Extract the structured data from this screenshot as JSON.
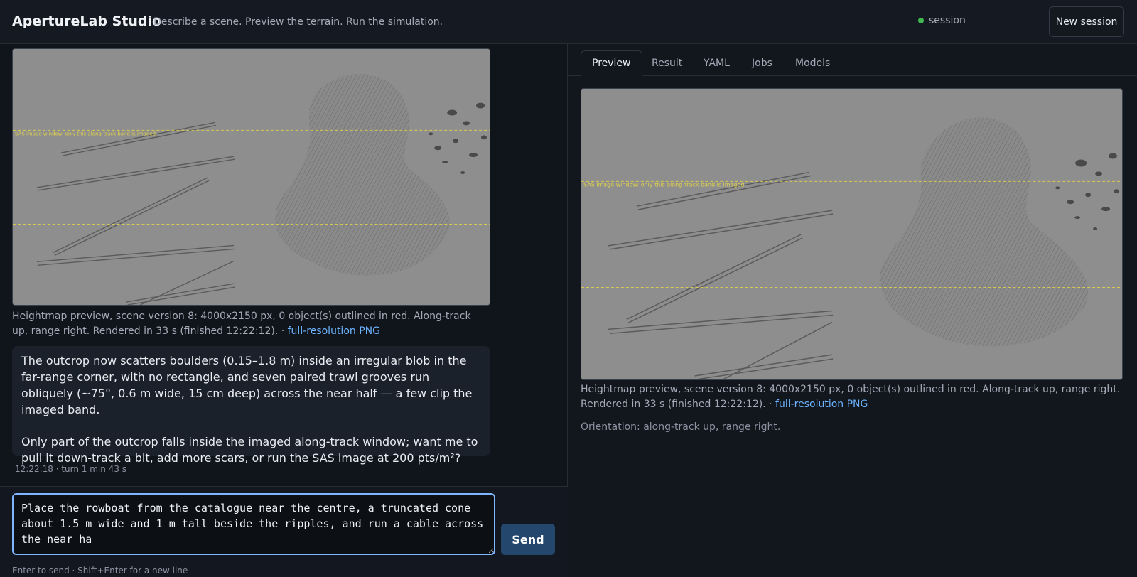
{
  "header": {
    "title": "ApertureLab Studio",
    "tagline": "Describe a scene. Preview the terrain. Run the simulation.",
    "session_label": "session",
    "session_status_color": "#3fb950",
    "new_session_label": "New session"
  },
  "chat": {
    "preview": {
      "overlay_label": "SAS image window: only this along-track band is imaged",
      "caption_text": "Heightmap preview, scene version 8: 4000x2150 px, 0 object(s) outlined in red. Along-track up, range right. Rendered in 33 s (finished 12:22:12). · ",
      "link_label": "full-resolution PNG"
    },
    "assistant_message": {
      "paragraph1": "The outcrop now scatters boulders (0.15–1.8 m) inside an irregular blob in the far-range corner, with no rectangle, and seven paired trawl grooves run obliquely (~75°, 0.6 m wide, 15 cm deep) across the near half — a few clip the imaged band.",
      "paragraph2": "Only part of the outcrop falls inside the imaged along-track window; want me to pull it down-track a bit, add more scars, or run the SAS image at 200 pts/m²?"
    },
    "meta": "12:22:18 · turn 1 min 43 s"
  },
  "composer": {
    "value": "Place the rowboat from the catalogue near the centre, a truncated cone about 1.5 m wide and 1 m tall beside the ripples, and run a cable across the near ha",
    "send_label": "Send",
    "hint": "Enter to send · Shift+Enter for a new line"
  },
  "tabs": [
    {
      "label": "Preview",
      "active": true
    },
    {
      "label": "Result",
      "active": false
    },
    {
      "label": "YAML",
      "active": false
    },
    {
      "label": "Jobs",
      "active": false
    },
    {
      "label": "Models",
      "active": false
    }
  ],
  "preview_panel": {
    "overlay_label": "SAS image window: only this along-track band is imaged",
    "caption_text": "Heightmap preview, scene version 8: 4000x2150 px, 0 object(s) outlined in red. Along-track up, range right. Rendered in 33 s (finished 12:22:12). · ",
    "link_label": "full-resolution PNG",
    "orientation": "Orientation: along-track up, range right."
  },
  "colors": {
    "accent": "#7fb6ff",
    "link": "#6cb4ff",
    "send_button": "#24476e",
    "overlay_line": "#e0d24a"
  }
}
